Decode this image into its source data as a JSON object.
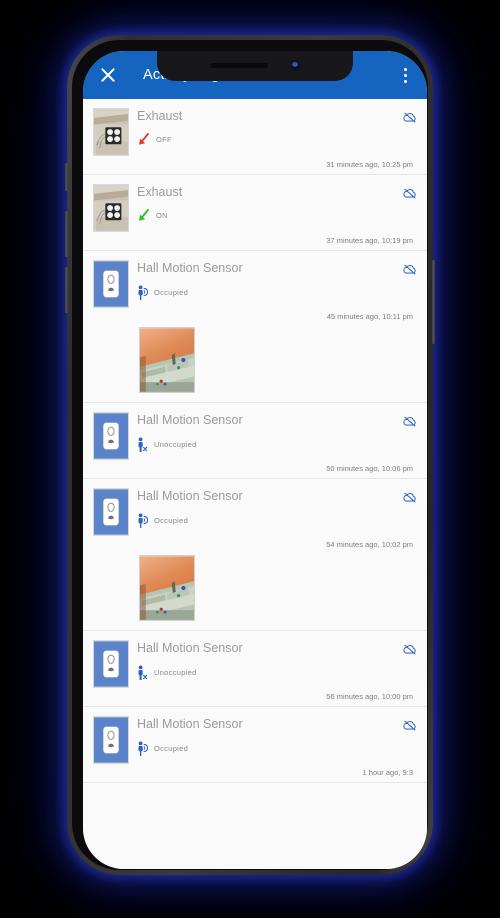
{
  "app": {
    "title": "Activity Log",
    "close_label": "×",
    "close_icon": "close-icon",
    "overflow_icon": "more-vertical-icon",
    "header_color": "#1565c0"
  },
  "colors": {
    "header_blue": "#1565c0",
    "accent_blue": "#3d6fc4",
    "on_green": "#22c522",
    "off_red": "#e53935",
    "device_name_gray": "#9b9b9b",
    "timestamp_gray": "#7d7d7d"
  },
  "list": {
    "items": [
      {
        "device": "Exhaust",
        "state": "OFF",
        "state_kind": "off",
        "arrow_icon": "arrow-down-left-red-icon",
        "arrow_color": "#e53935",
        "thumb": "exhaust-fan-photo",
        "cloud_icon": "cloud-off-icon",
        "timestamp": "31 minutes ago, 10:25 pm",
        "attachment": null
      },
      {
        "device": "Exhaust",
        "state": "ON",
        "state_kind": "on",
        "arrow_icon": "arrow-down-left-green-icon",
        "arrow_color": "#22c522",
        "thumb": "exhaust-fan-photo",
        "cloud_icon": "cloud-off-icon",
        "timestamp": "37 minutes ago, 10:19 pm",
        "attachment": null
      },
      {
        "device": "Hall Motion Sensor",
        "state": "Occupied",
        "state_kind": "occupied",
        "arrow_icon": "person-motion-icon",
        "arrow_color": "#2f63b8",
        "thumb": "motion-sensor-icon",
        "cloud_icon": "cloud-off-icon",
        "timestamp": "45 minutes ago, 10:11 pm",
        "attachment": "sofa-photo"
      },
      {
        "device": "Hall Motion Sensor",
        "state": "Unoccupied",
        "state_kind": "unoccupied",
        "arrow_icon": "person-x-icon",
        "arrow_color": "#2f63b8",
        "thumb": "motion-sensor-icon",
        "cloud_icon": "cloud-off-icon",
        "timestamp": "50 minutes ago, 10:06 pm",
        "attachment": null
      },
      {
        "device": "Hall Motion Sensor",
        "state": "Occupied",
        "state_kind": "occupied",
        "arrow_icon": "person-motion-icon",
        "arrow_color": "#2f63b8",
        "thumb": "motion-sensor-icon",
        "cloud_icon": "cloud-off-icon",
        "timestamp": "54 minutes ago, 10:02 pm",
        "attachment": "sofa-photo"
      },
      {
        "device": "Hall Motion Sensor",
        "state": "Unoccupied",
        "state_kind": "unoccupied",
        "arrow_icon": "person-x-icon",
        "arrow_color": "#2f63b8",
        "thumb": "motion-sensor-icon",
        "cloud_icon": "cloud-off-icon",
        "timestamp": "56 minutes ago, 10:00 pm",
        "attachment": null
      },
      {
        "device": "Hall Motion Sensor",
        "state": "Occupied",
        "state_kind": "occupied",
        "arrow_icon": "person-motion-icon",
        "arrow_color": "#2f63b8",
        "thumb": "motion-sensor-icon",
        "cloud_icon": "cloud-off-icon",
        "timestamp": "1 hour ago, 9:3",
        "attachment": null
      }
    ]
  }
}
